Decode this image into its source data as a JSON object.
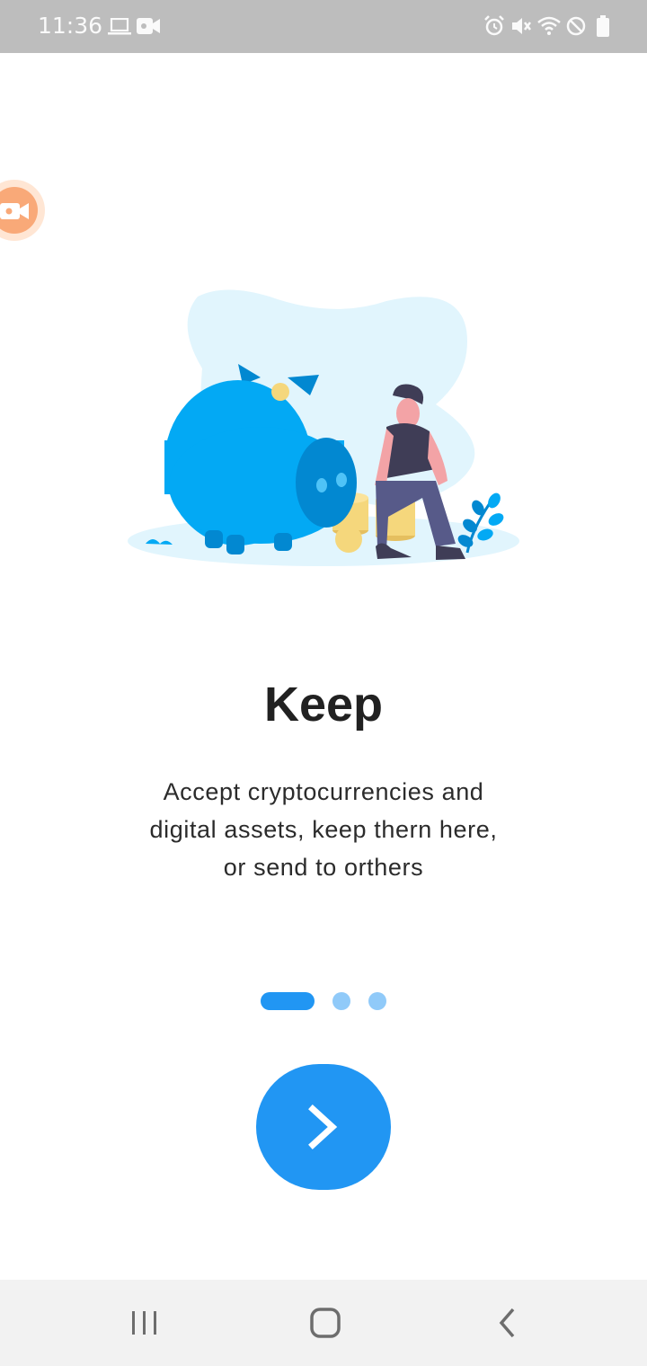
{
  "status_bar": {
    "time": "11:36",
    "left_icons": [
      "laptop-icon",
      "video-camera-icon"
    ],
    "right_icons": [
      "alarm-icon",
      "mute-icon",
      "wifi-icon",
      "do-not-disturb-icon",
      "battery-icon"
    ]
  },
  "overlay": {
    "icon": "video-camera-icon",
    "color": "#f9a978"
  },
  "onboarding": {
    "illustration": "piggy-bank-illustration",
    "title": "Keep",
    "description": "Accept cryptocurrencies and digital assets, keep thern here, or send to orthers",
    "page_indicator": {
      "total": 3,
      "current": 1
    },
    "next_icon": "chevron-right-icon"
  },
  "colors": {
    "accent": "#2196f3",
    "accent_light": "#90caf9",
    "pig": "#03a9f4",
    "background": "#ffffff"
  },
  "nav_bar": {
    "buttons": [
      "recent-apps-icon",
      "home-icon",
      "back-icon"
    ]
  }
}
